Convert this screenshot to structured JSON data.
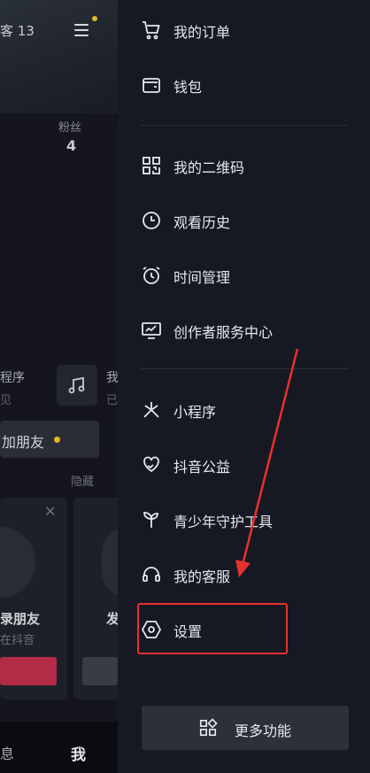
{
  "background_page": {
    "visitor_text": "客 13",
    "fans_label": "粉丝",
    "fans_count": "4",
    "mini_program_label": "程序",
    "mini_program_sub": "见",
    "music_label": "我",
    "music_sub": "已",
    "add_friend_label": "加朋友",
    "hide_label": "隐藏",
    "recommend_name": "录朋友",
    "recommend_sub": "在抖音",
    "recommend_name_2": "发",
    "tab_message": "息",
    "tab_me": "我"
  },
  "drawer": {
    "group1": [
      {
        "label": "我的订单",
        "icon": "cart-icon"
      },
      {
        "label": "钱包",
        "icon": "wallet-icon"
      }
    ],
    "group2": [
      {
        "label": "我的二维码",
        "icon": "qrcode-icon"
      },
      {
        "label": "观看历史",
        "icon": "clock-icon"
      },
      {
        "label": "时间管理",
        "icon": "alarm-icon"
      },
      {
        "label": "创作者服务中心",
        "icon": "monitor-chart-icon"
      }
    ],
    "group3": [
      {
        "label": "小程序",
        "icon": "sparkle-icon"
      },
      {
        "label": "抖音公益",
        "icon": "heart-hand-icon"
      },
      {
        "label": "青少年守护工具",
        "icon": "sprout-icon"
      },
      {
        "label": "我的客服",
        "icon": "headset-icon"
      },
      {
        "label": "设置",
        "icon": "hexagon-settings-icon"
      }
    ],
    "more_button_label": "更多功能"
  },
  "colors": {
    "drawer_bg": "#161823",
    "annotation": "#e8312f",
    "badge": "#e0b727"
  }
}
